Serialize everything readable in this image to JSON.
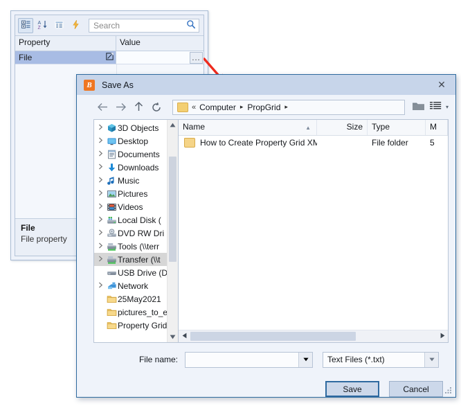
{
  "property_grid": {
    "toolbar": {
      "buttons": [
        {
          "name": "categorized-view-icon",
          "title": "Categorized"
        },
        {
          "name": "alphabetical-sort-icon",
          "title": "Alphabetical"
        },
        {
          "name": "properties-icon",
          "title": "Properties"
        },
        {
          "name": "events-icon",
          "title": "Events"
        }
      ],
      "search_placeholder": "Search",
      "search_value": ""
    },
    "columns": {
      "property": "Property",
      "value": "Value"
    },
    "rows": [
      {
        "property": "File",
        "value": "",
        "editor_button": "...",
        "selected": true
      }
    ],
    "description": {
      "title": "File",
      "text": "File property"
    }
  },
  "annotation": {
    "arrow_color": "#ee2b1e"
  },
  "dialog": {
    "app_icon_letter": "B",
    "title": "Save As",
    "close_label": "✕",
    "nav": {
      "back": "←",
      "forward": "→",
      "up": "↑",
      "refresh": "↻"
    },
    "address": {
      "collapse": "«",
      "segments": [
        "Computer",
        "PropGrid"
      ],
      "separator": "▸"
    },
    "toolbar": {
      "new_folder": "new-folder-icon",
      "view_mode": "view-mode-icon",
      "view_dropdown": "▾"
    },
    "tree": [
      {
        "label": "3D Objects",
        "icon": "3d-objects-icon",
        "expandable": true,
        "selected": false
      },
      {
        "label": "Desktop",
        "icon": "desktop-icon",
        "expandable": true,
        "selected": false
      },
      {
        "label": "Documents",
        "icon": "documents-icon",
        "expandable": true,
        "selected": false
      },
      {
        "label": "Downloads",
        "icon": "downloads-icon",
        "expandable": true,
        "selected": false
      },
      {
        "label": "Music",
        "icon": "music-icon",
        "expandable": true,
        "selected": false
      },
      {
        "label": "Pictures",
        "icon": "pictures-icon",
        "expandable": true,
        "selected": false
      },
      {
        "label": "Videos",
        "icon": "videos-icon",
        "expandable": true,
        "selected": false
      },
      {
        "label": "Local Disk (",
        "icon": "local-disk-icon",
        "expandable": true,
        "selected": false
      },
      {
        "label": "DVD RW Dri",
        "icon": "dvd-drive-icon",
        "expandable": true,
        "selected": false
      },
      {
        "label": "Tools (\\\\terr",
        "icon": "network-drive-icon",
        "expandable": true,
        "selected": false
      },
      {
        "label": "Transfer (\\\\t",
        "icon": "network-drive-icon",
        "expandable": true,
        "selected": true
      },
      {
        "label": "USB Drive (D:",
        "icon": "usb-drive-icon",
        "expandable": false,
        "selected": false
      },
      {
        "label": "Network",
        "icon": "network-icon",
        "expandable": true,
        "selected": false
      },
      {
        "label": "25May2021",
        "icon": "folder-icon",
        "expandable": false,
        "selected": false
      },
      {
        "label": "pictures_to_e",
        "icon": "folder-icon",
        "expandable": false,
        "selected": false
      },
      {
        "label": "Property Grid",
        "icon": "folder-icon",
        "expandable": false,
        "selected": false
      }
    ],
    "file_list": {
      "columns": [
        {
          "label": "Name",
          "sorted": "asc",
          "sort_glyph": "▲"
        },
        {
          "label": "Size",
          "align": "right"
        },
        {
          "label": "Type"
        },
        {
          "label": "M"
        }
      ],
      "rows": [
        {
          "name": "How to Create Property Grid XML",
          "size": "",
          "type": "File folder",
          "modified": "5",
          "icon": "folder-icon"
        }
      ]
    },
    "form": {
      "filename_label": "File name:",
      "filename_value": "",
      "filter_value": "Text Files (*.txt)"
    },
    "buttons": {
      "save": "Save",
      "cancel": "Cancel"
    }
  }
}
